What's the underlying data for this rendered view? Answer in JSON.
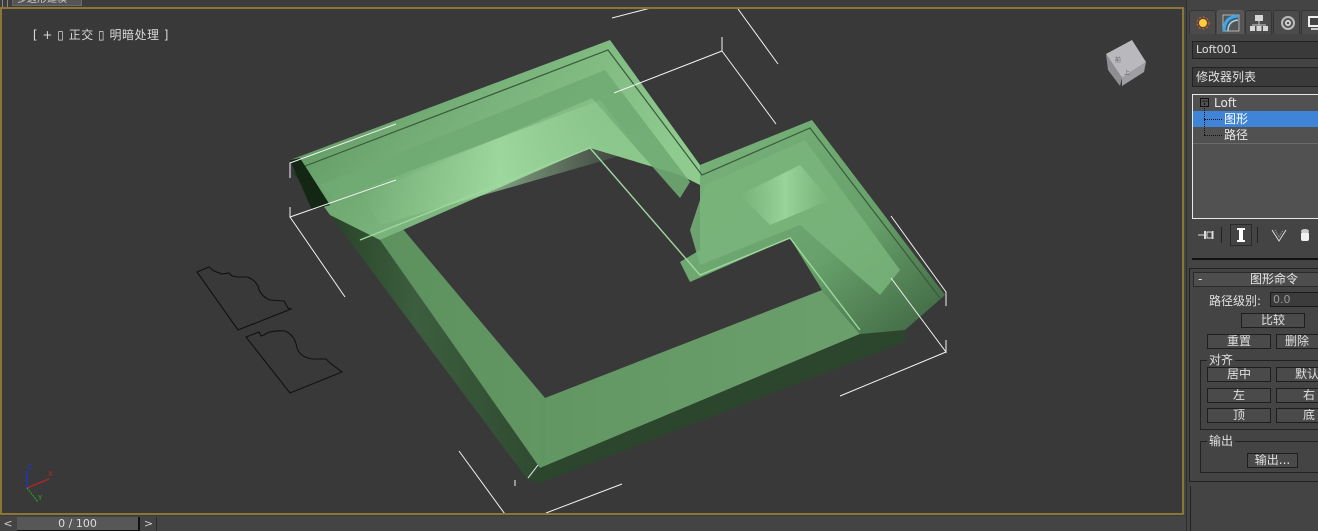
{
  "top_tab": {
    "label": "多边形建模"
  },
  "viewport": {
    "label_parts": [
      "[ ",
      "+",
      " ] ",
      "正交",
      " [ ",
      "明暗处理",
      " ]"
    ],
    "label_text": "[ + ▯ 正交 ▯ 明暗处理 ]",
    "object_color": "#6a9e6a",
    "border_color": "#8a7636",
    "axis": {
      "x": "X",
      "y": "Y",
      "z": "Z",
      "x_color": "#cc2222",
      "y_color": "#22aa22",
      "z_color": "#2233dd"
    },
    "viewcube_icon": "viewcube-icon"
  },
  "timeline": {
    "prev": "<",
    "next": ">",
    "position": "0 / 100",
    "current_frame": 0,
    "total_frames": 100
  },
  "command_panel": {
    "tabs": [
      {
        "name": "create",
        "icon": "create-star-icon"
      },
      {
        "name": "modify",
        "icon": "modify-arc-icon",
        "active": true
      },
      {
        "name": "hierarchy",
        "icon": "hierarchy-icon"
      },
      {
        "name": "motion",
        "icon": "motion-disc-icon"
      },
      {
        "name": "display",
        "icon": "display-monitor-icon"
      }
    ],
    "object_name": "Loft001",
    "modifier_list": "修改器列表",
    "stack": {
      "root": {
        "toggle": "−",
        "label": "Loft"
      },
      "items": [
        {
          "label": "图形",
          "selected": true
        },
        {
          "label": "路径",
          "selected": false
        }
      ]
    },
    "stack_tools": [
      "pin-stack-icon",
      "show-end-result-icon",
      "make-unique-icon",
      "remove-modifier-icon"
    ],
    "rollout": {
      "toggle": "-",
      "title": "图形命令",
      "path_level_label": "路径级别:",
      "path_level_value": "0.0",
      "compare_button": "比较",
      "reset_button": "重置",
      "delete_button": "删除",
      "align_group": {
        "title": "对齐",
        "buttons": [
          "居中",
          "默认",
          "左",
          "右",
          "顶",
          "底"
        ]
      },
      "output_group": {
        "title": "输出",
        "button": "输出..."
      }
    }
  }
}
